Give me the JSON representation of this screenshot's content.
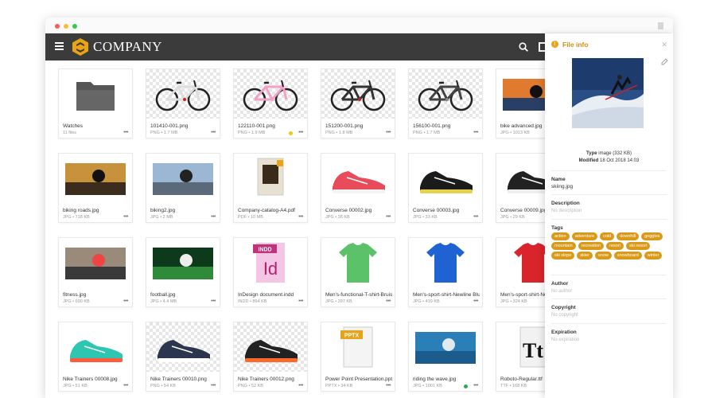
{
  "app": {
    "brand": "COMPANY"
  },
  "files": [
    {
      "name": "Watches",
      "meta": "11 files",
      "kind": "folder"
    },
    {
      "name": "101410-001.png",
      "meta": "PNG • 1.7 MB",
      "kind": "bike-white"
    },
    {
      "name": "122110-001.png",
      "meta": "PNG • 1.9 MB",
      "kind": "bike-pink",
      "fav": "#f2c811"
    },
    {
      "name": "151200-001.png",
      "meta": "PNG • 1.8 MB",
      "kind": "bike-black"
    },
    {
      "name": "156100-001.png",
      "meta": "PNG • 1.7 MB",
      "kind": "bike-mtb"
    },
    {
      "name": "bike advanced.jpg",
      "meta": "JPG • 1013 KB",
      "kind": "photo-sunset"
    },
    {
      "name": "biking roads.jpg",
      "meta": "JPG • 718 KB",
      "kind": "photo-road"
    },
    {
      "name": "biking2.jpg",
      "meta": "JPG • 2 MB",
      "kind": "photo-race"
    },
    {
      "name": "Company-catalog-A4.pdf",
      "meta": "PDF • 10 MB",
      "kind": "pdf"
    },
    {
      "name": "Converse 00002.jpg",
      "meta": "JPG • 38 KB",
      "kind": "shoe-red"
    },
    {
      "name": "Converse 00003.jpg",
      "meta": "JPG • 33 KB",
      "kind": "shoe-black"
    },
    {
      "name": "Converse 00009.jpg",
      "meta": "JPG • 29 KB",
      "kind": "shoe-black2"
    },
    {
      "name": "fitness.jpg",
      "meta": "JPG • 690 KB",
      "kind": "photo-gym"
    },
    {
      "name": "football.jpg",
      "meta": "JPG • 4.4 MB",
      "kind": "photo-football"
    },
    {
      "name": "InDesign document.indd",
      "meta": "INDD • 864 KB",
      "kind": "indd"
    },
    {
      "name": "Men's-functional-T-shirt-Bruis",
      "meta": "JPG • 287 KB",
      "kind": "shirt-green"
    },
    {
      "name": "Men's-sport-shirt-Newline Blue",
      "meta": "JPG • 419 KB",
      "kind": "shirt-blue"
    },
    {
      "name": "Men's-sport-shirt-Newline Red",
      "meta": "JPG • 324 KB",
      "kind": "shirt-red"
    },
    {
      "name": "Nike Trainers 00008.jpg",
      "meta": "JPG • 51 KB",
      "kind": "trainer-teal"
    },
    {
      "name": "Nike Trainers 00010.png",
      "meta": "PNG • 54 KB",
      "kind": "trainer-navy"
    },
    {
      "name": "Nike Trainers 00012.png",
      "meta": "PNG • 52 KB",
      "kind": "trainer-dark"
    },
    {
      "name": "Power Point Presentation.pptx",
      "meta": "PPTX • 34 KB",
      "kind": "pptx"
    },
    {
      "name": "riding the wave.jpg",
      "meta": "JPG • 1001 KB",
      "kind": "photo-wave",
      "fav": "#2fa84f"
    },
    {
      "name": "Roboto-Regular.ttf",
      "meta": "TTF • 168 KB",
      "kind": "font"
    }
  ],
  "panel": {
    "title": "File info",
    "type_label": "Type",
    "type_value": "image (332 KB)",
    "modified_label": "Modified",
    "modified_value": "18 Oct 2018 14:03",
    "name_label": "Name",
    "name_value": "skiing.jpg",
    "description_label": "Description",
    "description_value": "No description",
    "tags_label": "Tags",
    "tags": [
      "action",
      "adventure",
      "cold",
      "downhill",
      "goggles",
      "mountain",
      "recreation",
      "resort",
      "ski resort",
      "ski slope",
      "skier",
      "snow",
      "snowboard",
      "winter"
    ],
    "author_label": "Author",
    "author_value": "No author",
    "copyright_label": "Copyright",
    "copyright_value": "No copyright",
    "expiration_label": "Expiration",
    "expiration_value": "No expiration"
  },
  "colors": {
    "accent": "#d99a1a",
    "appbar": "#3b3b3b"
  }
}
